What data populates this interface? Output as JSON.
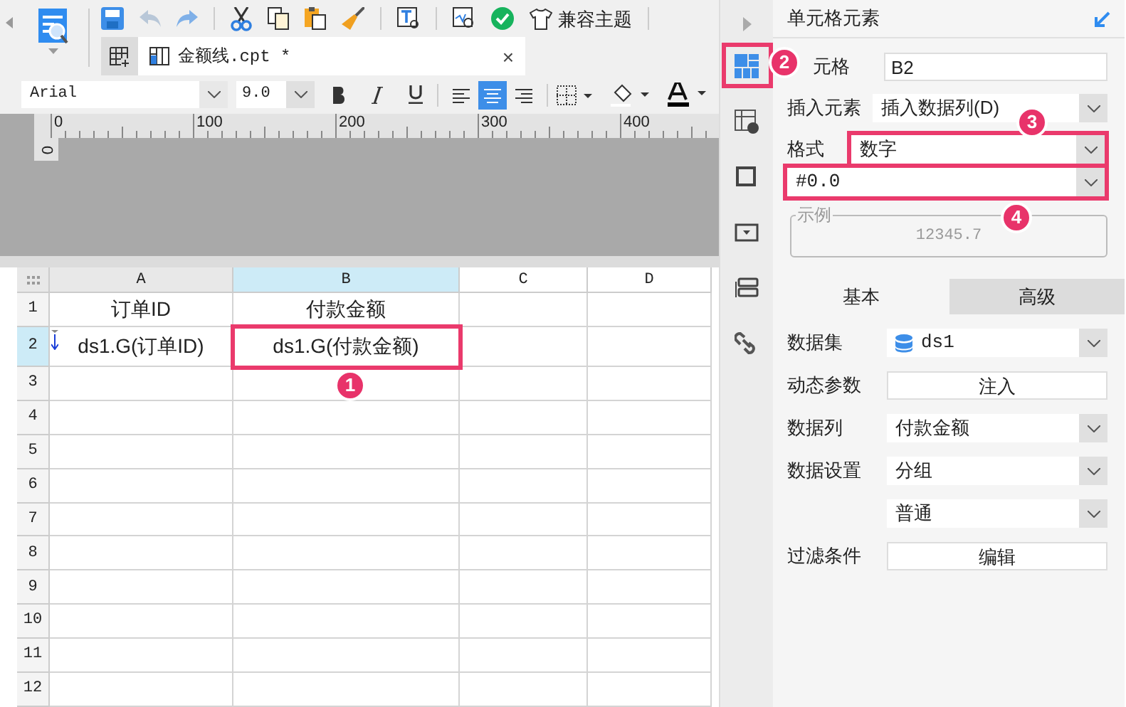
{
  "toolbar": {
    "theme_button": "兼容主题"
  },
  "tabs": [
    {
      "label": "金额线.cpt *",
      "selected": true,
      "close": "×"
    }
  ],
  "format_bar": {
    "font": "Arial",
    "size": "9.0",
    "align": [
      {
        "selected": false
      },
      {
        "selected": true
      },
      {
        "selected": false
      }
    ]
  },
  "ruler": {
    "marks": [
      "0",
      "100",
      "200",
      "300",
      "400"
    ],
    "vertical": "0"
  },
  "sheet": {
    "columns": [
      {
        "label": "A",
        "selected": false
      },
      {
        "label": "B",
        "selected": true
      },
      {
        "label": "C",
        "selected": false
      },
      {
        "label": "D",
        "selected": false
      }
    ],
    "rows": [
      {
        "number": "1",
        "selected": false,
        "cells": [
          {
            "text": "订单ID",
            "expand": false,
            "highlighted": false
          },
          {
            "text": "付款金额",
            "expand": false,
            "highlighted": false
          }
        ]
      },
      {
        "number": "2",
        "selected": true,
        "cells": [
          {
            "text": "ds1.G(订单ID)",
            "expand": true,
            "highlighted": false
          },
          {
            "text": "ds1.G(付款金额)",
            "expand": false,
            "highlighted": true
          }
        ]
      },
      {
        "number": "3",
        "selected": false
      },
      {
        "number": "4",
        "selected": false
      },
      {
        "number": "5",
        "selected": false
      },
      {
        "number": "6",
        "selected": false
      },
      {
        "number": "7",
        "selected": false
      },
      {
        "number": "8",
        "selected": false
      },
      {
        "number": "9",
        "selected": false
      },
      {
        "number": "10",
        "selected": false
      },
      {
        "number": "11",
        "selected": false
      },
      {
        "number": "12",
        "selected": false
      }
    ]
  },
  "side_icons": [
    {
      "kind": "cell",
      "highlighted": true
    },
    {
      "kind": "info",
      "highlighted": false
    },
    {
      "kind": "frame",
      "highlighted": false
    },
    {
      "kind": "widget",
      "highlighted": false
    },
    {
      "kind": "list",
      "highlighted": false
    },
    {
      "kind": "link",
      "highlighted": false
    }
  ],
  "panel": {
    "title": "单元格元素",
    "cell_label": "元格",
    "cell_value": "B2",
    "insert_label": "插入元素",
    "insert_value": "插入数据列(D)",
    "format_label": "格式",
    "format_value": "数字",
    "format_highlighted": true,
    "pattern_value": "#0.0",
    "pattern_highlighted": true,
    "example_label": "示例",
    "example_value": "12345.7",
    "tabs": [
      {
        "label": "基本",
        "selected": true
      },
      {
        "label": "高级",
        "selected": false
      }
    ],
    "rows": [
      {
        "kind": "dataset",
        "label": "数据集",
        "value": "ds1"
      },
      {
        "kind": "button",
        "label": "动态参数",
        "value": "注入"
      },
      {
        "kind": "select",
        "label": "数据列",
        "value": "付款金额"
      },
      {
        "kind": "select",
        "label": "数据设置",
        "value": "分组"
      },
      {
        "kind": "select",
        "value": "普通"
      },
      {
        "kind": "button",
        "label": "过滤条件",
        "value": "编辑"
      }
    ]
  },
  "annotations": [
    {
      "number": "1"
    },
    {
      "number": "2"
    },
    {
      "number": "3"
    },
    {
      "number": "4"
    }
  ]
}
